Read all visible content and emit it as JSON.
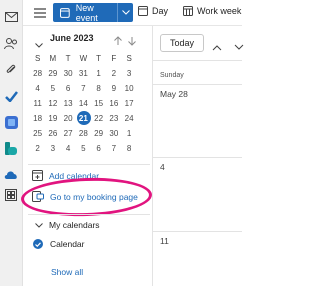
{
  "toolbar": {
    "new_event_label": "New event",
    "view_day_label": "Day",
    "view_week_label": "Work week"
  },
  "mini_calendar": {
    "title": "June 2023",
    "weekday_headers": [
      "S",
      "M",
      "T",
      "W",
      "T",
      "F",
      "S"
    ],
    "weeks": [
      [
        "28",
        "29",
        "30",
        "31",
        "1",
        "2",
        "3"
      ],
      [
        "4",
        "5",
        "6",
        "7",
        "8",
        "9",
        "10"
      ],
      [
        "11",
        "12",
        "13",
        "14",
        "15",
        "16",
        "17"
      ],
      [
        "18",
        "19",
        "20",
        "21",
        "22",
        "23",
        "24"
      ],
      [
        "25",
        "26",
        "27",
        "28",
        "29",
        "30",
        "1"
      ],
      [
        "2",
        "3",
        "4",
        "5",
        "6",
        "7",
        "8"
      ]
    ],
    "selected_day": "21"
  },
  "left_nav": {
    "add_calendar_label": "Add calendar",
    "booking_page_label": "Go to my booking page",
    "my_calendars_label": "My calendars",
    "calendar_item_label": "Calendar",
    "show_all_label": "Show all"
  },
  "main": {
    "today_button_label": "Today",
    "day_header": "Sunday",
    "cells": [
      "May 28",
      "4",
      "11"
    ]
  },
  "colors": {
    "accent": "#1f6ab8",
    "highlight": "#e1147f"
  }
}
